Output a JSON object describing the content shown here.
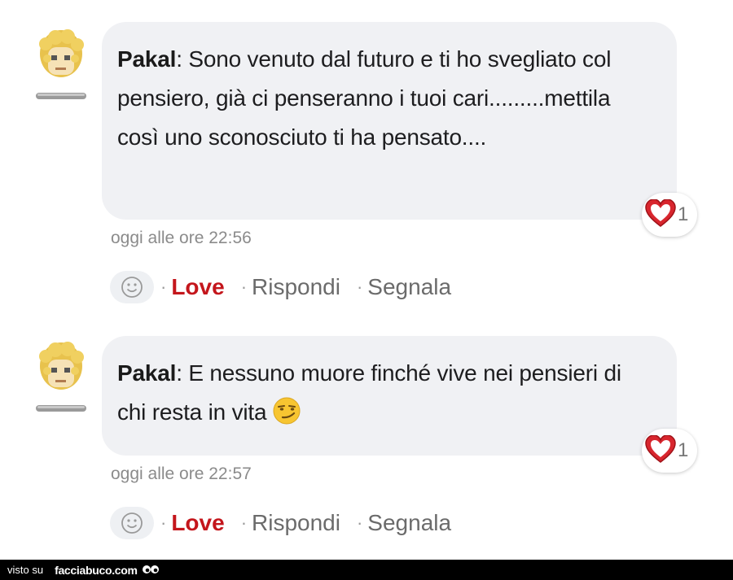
{
  "comments": [
    {
      "author": "Pakal",
      "separator": ": ",
      "text": "Sono venuto dal futuro e ti ho svegliato col pensiero, già ci penseranno i tuoi cari.........mettila così uno sconosciuto ti ha pensato....",
      "timestamp": "oggi alle ore 22:56",
      "reaction_count": "1",
      "actions": {
        "love": "Love",
        "reply": "Rispondi",
        "report": "Segnala",
        "dot": "·"
      }
    },
    {
      "author": "Pakal",
      "separator": ": ",
      "text": "E nessuno muore finché vive nei pensieri di chi resta in vita",
      "trailing_emoji": "smirk-emoji",
      "timestamp": "oggi alle ore 22:57",
      "reaction_count": "1",
      "actions": {
        "love": "Love",
        "reply": "Rispondi",
        "report": "Segnala",
        "dot": "·"
      }
    }
  ],
  "footer": {
    "prefix": "visto su",
    "brand": "facciabuco.com",
    "logo_icon": "eyes-icon"
  },
  "icons": {
    "avatar": "blond-avatar-icon",
    "reaction": "heart-icon",
    "add_reaction": "smiley-icon"
  },
  "colors": {
    "love": "#c4161c",
    "bubble": "#f0f1f4",
    "heart": "#d8262e"
  }
}
